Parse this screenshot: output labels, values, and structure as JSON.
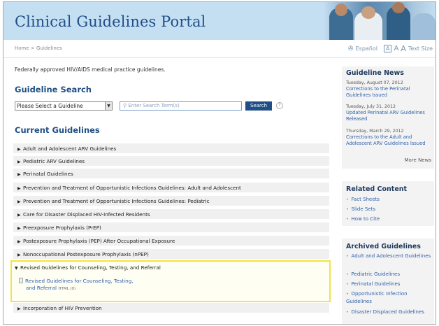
{
  "header": {
    "title": "Clinical Guidelines Portal"
  },
  "breadcrumb": "Home > Guidelines",
  "tools": {
    "language": "Español",
    "font_small": "A",
    "font_medium": "A",
    "font_large": "A",
    "text_size_label": "Text Size"
  },
  "main": {
    "intro": "Federally approved HIV/AIDS medical practice guidelines.",
    "search_heading": "Guideline Search",
    "select_value": "Please Select a Guideline",
    "search_placeholder": "Enter Search Term(s)",
    "search_button": "Search",
    "help_symbol": "?",
    "current_heading": "Current Guidelines",
    "guidelines": [
      "Adult and Adolescent ARV Guidelines",
      "Pediatric ARV Guidelines",
      "Perinatal Guidelines",
      "Prevention and Treatment of Opportunistic Infections Guidelines: Adult and Adolescent",
      "Prevention and Treatment of Opportunistic Infections Guidelines: Pediatric",
      "Care for Disaster Displaced HIV-Infected Residents",
      "Preexposure Prophylaxis (PrEP)",
      "Postexposure Prophylaxis (PEP) After Occupational Exposure",
      "Nonoccupational Postexposure Prophylaxis (nPEP)"
    ],
    "expanded": {
      "title": "Revised Guidelines for Counseling, Testing, and Referral",
      "link_line1": "Revised Guidelines for Counseling, Testing,",
      "link_line2": "and Referral",
      "format": "HTML (0)"
    },
    "last_guideline": "Incorporation of HIV Prevention"
  },
  "sidebar": {
    "news_title": "Guideline News",
    "news": [
      {
        "date": "Tuesday, August 07, 2012",
        "text": "Corrections to the Perinatal Guidelines Issued"
      },
      {
        "date": "Tuesday, July 31, 2012",
        "text": "Updated Perinatal ARV Guidelines Released"
      },
      {
        "date": "Thursday, March 29, 2012",
        "text": "Corrections to the Adult and Adolescent ARV Guidelines Issued"
      }
    ],
    "more_news": "More News",
    "related_title": "Related Content",
    "related": [
      "Fact Sheets",
      "Slide Sets",
      "How to Cite"
    ],
    "archived_title": "Archived Guidelines",
    "archived": [
      "Adult and Adolescent Guidelines",
      "Pediatric Guidelines",
      "Perinatal Guidelines",
      "Opportunistic Infection Guidelines",
      "Disaster Displaced Guidelines"
    ]
  }
}
